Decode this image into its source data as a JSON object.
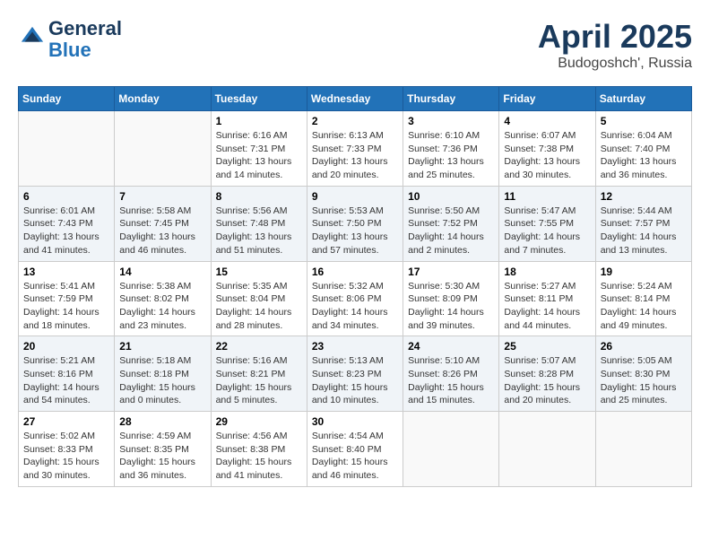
{
  "logo": {
    "general": "General",
    "blue": "Blue"
  },
  "header": {
    "month": "April 2025",
    "location": "Budogoshch', Russia"
  },
  "weekdays": [
    "Sunday",
    "Monday",
    "Tuesday",
    "Wednesday",
    "Thursday",
    "Friday",
    "Saturday"
  ],
  "weeks": [
    [
      {
        "day": "",
        "info": ""
      },
      {
        "day": "",
        "info": ""
      },
      {
        "day": "1",
        "info": "Sunrise: 6:16 AM\nSunset: 7:31 PM\nDaylight: 13 hours and 14 minutes."
      },
      {
        "day": "2",
        "info": "Sunrise: 6:13 AM\nSunset: 7:33 PM\nDaylight: 13 hours and 20 minutes."
      },
      {
        "day": "3",
        "info": "Sunrise: 6:10 AM\nSunset: 7:36 PM\nDaylight: 13 hours and 25 minutes."
      },
      {
        "day": "4",
        "info": "Sunrise: 6:07 AM\nSunset: 7:38 PM\nDaylight: 13 hours and 30 minutes."
      },
      {
        "day": "5",
        "info": "Sunrise: 6:04 AM\nSunset: 7:40 PM\nDaylight: 13 hours and 36 minutes."
      }
    ],
    [
      {
        "day": "6",
        "info": "Sunrise: 6:01 AM\nSunset: 7:43 PM\nDaylight: 13 hours and 41 minutes."
      },
      {
        "day": "7",
        "info": "Sunrise: 5:58 AM\nSunset: 7:45 PM\nDaylight: 13 hours and 46 minutes."
      },
      {
        "day": "8",
        "info": "Sunrise: 5:56 AM\nSunset: 7:48 PM\nDaylight: 13 hours and 51 minutes."
      },
      {
        "day": "9",
        "info": "Sunrise: 5:53 AM\nSunset: 7:50 PM\nDaylight: 13 hours and 57 minutes."
      },
      {
        "day": "10",
        "info": "Sunrise: 5:50 AM\nSunset: 7:52 PM\nDaylight: 14 hours and 2 minutes."
      },
      {
        "day": "11",
        "info": "Sunrise: 5:47 AM\nSunset: 7:55 PM\nDaylight: 14 hours and 7 minutes."
      },
      {
        "day": "12",
        "info": "Sunrise: 5:44 AM\nSunset: 7:57 PM\nDaylight: 14 hours and 13 minutes."
      }
    ],
    [
      {
        "day": "13",
        "info": "Sunrise: 5:41 AM\nSunset: 7:59 PM\nDaylight: 14 hours and 18 minutes."
      },
      {
        "day": "14",
        "info": "Sunrise: 5:38 AM\nSunset: 8:02 PM\nDaylight: 14 hours and 23 minutes."
      },
      {
        "day": "15",
        "info": "Sunrise: 5:35 AM\nSunset: 8:04 PM\nDaylight: 14 hours and 28 minutes."
      },
      {
        "day": "16",
        "info": "Sunrise: 5:32 AM\nSunset: 8:06 PM\nDaylight: 14 hours and 34 minutes."
      },
      {
        "day": "17",
        "info": "Sunrise: 5:30 AM\nSunset: 8:09 PM\nDaylight: 14 hours and 39 minutes."
      },
      {
        "day": "18",
        "info": "Sunrise: 5:27 AM\nSunset: 8:11 PM\nDaylight: 14 hours and 44 minutes."
      },
      {
        "day": "19",
        "info": "Sunrise: 5:24 AM\nSunset: 8:14 PM\nDaylight: 14 hours and 49 minutes."
      }
    ],
    [
      {
        "day": "20",
        "info": "Sunrise: 5:21 AM\nSunset: 8:16 PM\nDaylight: 14 hours and 54 minutes."
      },
      {
        "day": "21",
        "info": "Sunrise: 5:18 AM\nSunset: 8:18 PM\nDaylight: 15 hours and 0 minutes."
      },
      {
        "day": "22",
        "info": "Sunrise: 5:16 AM\nSunset: 8:21 PM\nDaylight: 15 hours and 5 minutes."
      },
      {
        "day": "23",
        "info": "Sunrise: 5:13 AM\nSunset: 8:23 PM\nDaylight: 15 hours and 10 minutes."
      },
      {
        "day": "24",
        "info": "Sunrise: 5:10 AM\nSunset: 8:26 PM\nDaylight: 15 hours and 15 minutes."
      },
      {
        "day": "25",
        "info": "Sunrise: 5:07 AM\nSunset: 8:28 PM\nDaylight: 15 hours and 20 minutes."
      },
      {
        "day": "26",
        "info": "Sunrise: 5:05 AM\nSunset: 8:30 PM\nDaylight: 15 hours and 25 minutes."
      }
    ],
    [
      {
        "day": "27",
        "info": "Sunrise: 5:02 AM\nSunset: 8:33 PM\nDaylight: 15 hours and 30 minutes."
      },
      {
        "day": "28",
        "info": "Sunrise: 4:59 AM\nSunset: 8:35 PM\nDaylight: 15 hours and 36 minutes."
      },
      {
        "day": "29",
        "info": "Sunrise: 4:56 AM\nSunset: 8:38 PM\nDaylight: 15 hours and 41 minutes."
      },
      {
        "day": "30",
        "info": "Sunrise: 4:54 AM\nSunset: 8:40 PM\nDaylight: 15 hours and 46 minutes."
      },
      {
        "day": "",
        "info": ""
      },
      {
        "day": "",
        "info": ""
      },
      {
        "day": "",
        "info": ""
      }
    ]
  ]
}
